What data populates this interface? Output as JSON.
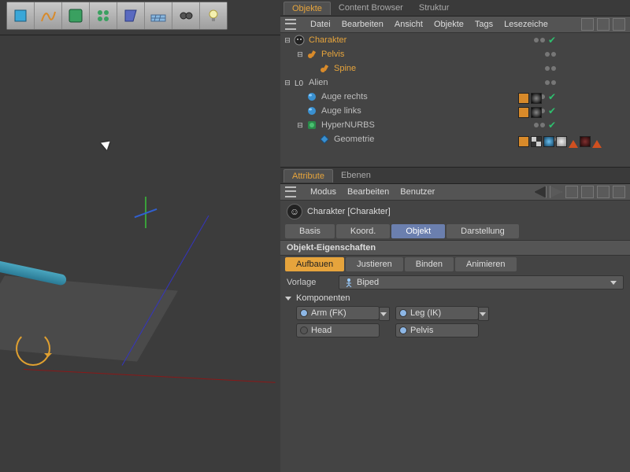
{
  "panels": {
    "objects": {
      "tabs": [
        "Objekte",
        "Content Browser",
        "Struktur"
      ],
      "active": 0,
      "menu": [
        "Datei",
        "Bearbeiten",
        "Ansicht",
        "Objekte",
        "Tags",
        "Lesezeiche"
      ]
    },
    "attributes": {
      "tabs": [
        "Attribute",
        "Ebenen"
      ],
      "active": 0,
      "menu": [
        "Modus",
        "Bearbeiten",
        "Benutzer"
      ]
    }
  },
  "tree": [
    {
      "indent": 0,
      "toggle": "⊟",
      "icon": "character",
      "name": "Charakter",
      "hl": true,
      "dots": true,
      "chk": true
    },
    {
      "indent": 1,
      "toggle": "⊟",
      "icon": "joint",
      "name": "Pelvis",
      "hl": true,
      "dots": true,
      "chk": false
    },
    {
      "indent": 2,
      "toggle": "",
      "icon": "joint",
      "name": "Spine",
      "hl": true,
      "dots": true,
      "chk": false
    },
    {
      "indent": 0,
      "toggle": "⊟",
      "icon": "null",
      "name": "Alien",
      "hl": false,
      "dots": true,
      "chk": false
    },
    {
      "indent": 1,
      "toggle": "",
      "icon": "sphere",
      "name": "Auge rechts",
      "hl": false,
      "dots": true,
      "chk": true,
      "tags": [
        "comp",
        "ball"
      ]
    },
    {
      "indent": 1,
      "toggle": "",
      "icon": "sphere",
      "name": "Auge links",
      "hl": false,
      "dots": true,
      "chk": true,
      "tags": [
        "comp",
        "ball"
      ]
    },
    {
      "indent": 1,
      "toggle": "⊟",
      "icon": "hypernurbs",
      "name": "HyperNURBS",
      "hl": false,
      "dots": true,
      "chk": true
    },
    {
      "indent": 2,
      "toggle": "",
      "icon": "poly",
      "name": "Geometrie",
      "hl": false,
      "dots": true,
      "chk": false,
      "tags": [
        "many"
      ]
    }
  ],
  "attr": {
    "title": "Charakter [Charakter]",
    "main_tabs": [
      "Basis",
      "Koord.",
      "Objekt",
      "Darstellung"
    ],
    "main_active": 2,
    "section": "Objekt-Eigenschaften",
    "sub_tabs": [
      "Aufbauen",
      "Justieren",
      "Binden",
      "Animieren"
    ],
    "sub_active": 0,
    "template_label": "Vorlage",
    "template_value": "Biped",
    "components_label": "Komponenten",
    "components": {
      "left": [
        {
          "label": "Arm (FK)",
          "led": true,
          "dd": true
        },
        {
          "label": "Head",
          "led": false,
          "dd": false
        }
      ],
      "right": [
        {
          "label": "Leg (IK)",
          "led": true,
          "dd": true
        },
        {
          "label": "Pelvis",
          "led": true,
          "dd": false
        }
      ]
    }
  }
}
